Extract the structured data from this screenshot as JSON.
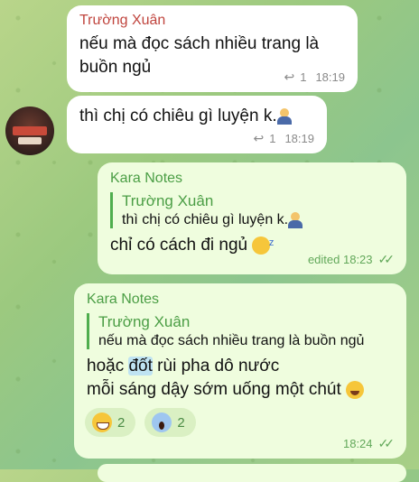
{
  "messages": [
    {
      "sender": "Trường Xuân",
      "text_line1": "nếu mà đọc sách nhiều trang là",
      "text_line2": "buồn ngủ",
      "reply_count": "1",
      "time": "18:19"
    },
    {
      "text": "thì chị có chiêu gì luyện k.",
      "reply_count": "1",
      "time": "18:19"
    },
    {
      "sender": "Kara Notes",
      "quote_name": "Trường Xuân",
      "quote_text": "thì chị có chiêu gì luyện k.",
      "text": "chỉ có cách đi ngủ",
      "status": "edited 18:23"
    },
    {
      "sender": "Kara Notes",
      "quote_name": "Trường Xuân",
      "quote_text": "nếu mà đọc sách nhiều trang là buồn ngủ",
      "line1_pre": "hoặc ",
      "line1_hl": "đốt",
      "line1_post": " rùi pha dô nước",
      "line2": "mỗi sáng dậy sớm uống một chút",
      "reactions": [
        {
          "icon": "grinning-face-icon",
          "count": "2"
        },
        {
          "icon": "screaming-face-icon",
          "count": "2"
        }
      ],
      "time": "18:24"
    }
  ],
  "colors": {
    "incoming": "#ffffff",
    "outgoing": "#effdde",
    "sender_red": "#c0453e",
    "sender_green": "#4b9e45"
  }
}
